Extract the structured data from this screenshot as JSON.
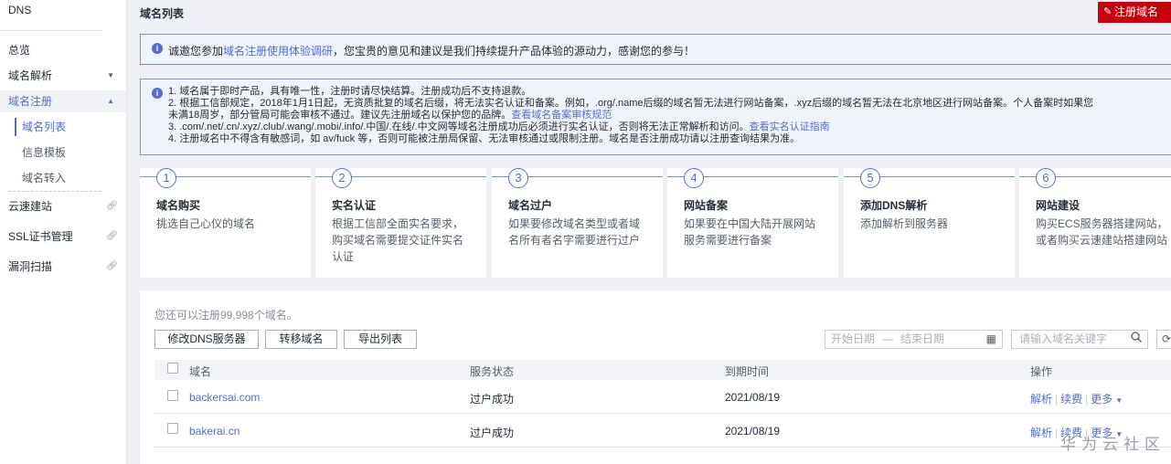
{
  "sidebar": {
    "title": "DNS",
    "items": [
      {
        "label": "总览"
      },
      {
        "label": "域名解析"
      },
      {
        "label": "域名注册"
      },
      {
        "label": "云速建站"
      },
      {
        "label": "SSL证书管理"
      },
      {
        "label": "漏洞扫描"
      }
    ],
    "sub_items": [
      {
        "label": "域名列表"
      },
      {
        "label": "信息模板"
      },
      {
        "label": "域名转入"
      }
    ]
  },
  "header": {
    "title": "域名列表",
    "register_button": "注册域名"
  },
  "notice1": {
    "prefix": "诚邀您参加",
    "link": "域名注册使用体验调研",
    "suffix": "，您宝贵的意见和建议是我们持续提升产品体验的源动力，感谢您的参与！"
  },
  "notice2": {
    "line1": "1. 域名属于即时产品，具有唯一性，注册时请尽快结算。注册成功后不支持退款。",
    "line2": "2. 根据工信部规定，2018年1月1日起，无资质批复的域名后缀，将无法实名认证和备案。例如，.org/.name后缀的域名暂无法进行网站备案，.xyz后缀的域名暂无法在北京地区进行网站备案。个人备案时如果您",
    "line3_text": "未满18周岁，部分管局可能会审核不通过。建议先注册域名以保护您的品牌。",
    "line3_link": "查看域名备案审核规范",
    "line4_text": "3. .com/.net/.cn/.xyz/.club/.wang/.mobi/.info/.中国/.在线/.中文网等域名注册成功后必须进行实名认证，否则将无法正常解析和访问。",
    "line4_link": "查看实名认证指南",
    "line5": "4. 注册域名中不得含有敏感词，如 av/fuck 等，否则可能被注册局保留、无法审核通过或限制注册。域名是否注册成功请以注册查询结果为准。"
  },
  "steps": [
    {
      "num": "1",
      "title": "域名购买",
      "desc": [
        "挑选自己心仪的域名"
      ]
    },
    {
      "num": "2",
      "title": "实名认证",
      "desc": [
        "根据工信部全面实名要求，",
        "购买域名需要提交证件实名",
        "认证"
      ]
    },
    {
      "num": "3",
      "title": "域名过户",
      "desc": [
        "如果要修改域名类型或者域",
        "名所有者名字需要进行过户"
      ]
    },
    {
      "num": "4",
      "title": "网站备案",
      "desc": [
        "如果要在中国大陆开展网站",
        "服务需要进行备案"
      ]
    },
    {
      "num": "5",
      "title": "添加DNS解析",
      "desc": [
        "添加解析到服务器"
      ]
    },
    {
      "num": "6",
      "title": "网站建设",
      "desc": [
        "购买ECS服务器搭建网站，",
        "或者购买云速建站搭建网站"
      ]
    }
  ],
  "toolbar": {
    "quota": "您还可以注册99,998个域名。",
    "btn_dns": "修改DNS服务器",
    "btn_transfer": "转移域名",
    "btn_export": "导出列表",
    "date_start": "开始日期",
    "date_sep": "—",
    "date_end": "结束日期",
    "search_placeholder": "请输入域名关键字"
  },
  "table": {
    "columns": [
      "域名",
      "服务状态",
      "到期时间",
      "操作"
    ],
    "rows": [
      {
        "name": "backersai.com",
        "status": "过户成功",
        "expire": "2021/08/19"
      },
      {
        "name": "bakerai.cn",
        "status": "过户成功",
        "expire": "2021/08/19"
      }
    ],
    "ops": {
      "resolve": "解析",
      "renew": "续费",
      "more": "更多"
    }
  },
  "watermark": "华为云社区",
  "colors": {
    "brand_red": "#c7000b",
    "link_blue": "#526ecc",
    "notice_bg": "#eef3fc"
  }
}
